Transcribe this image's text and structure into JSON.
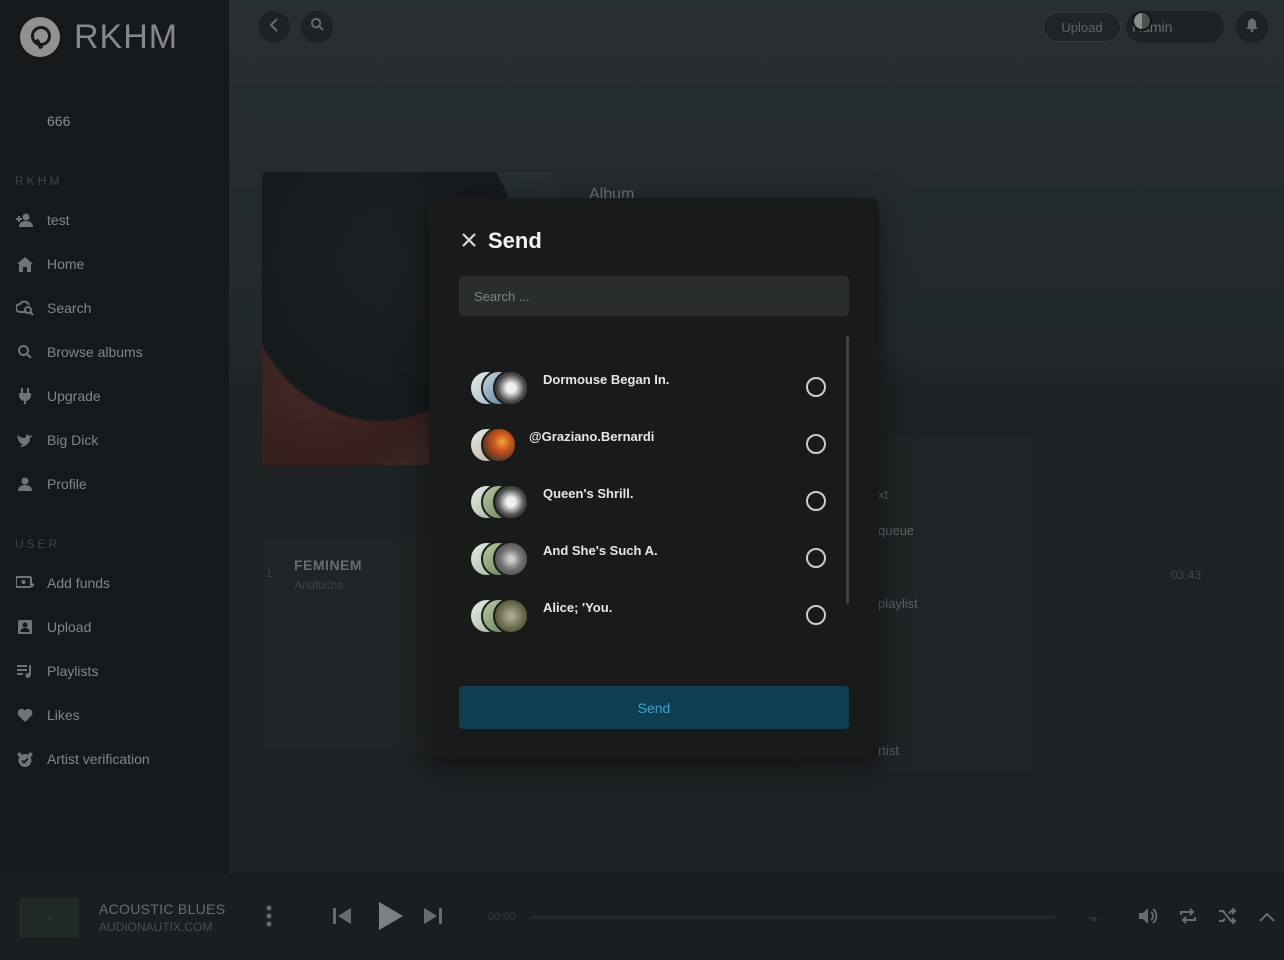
{
  "app": {
    "name": "RKHM"
  },
  "sidebar": {
    "balance": "666",
    "section_rkhm": "RKHM",
    "section_user": "USER",
    "items": [
      {
        "label": "test",
        "icon": "add-user-icon"
      },
      {
        "label": "Home",
        "icon": "home-icon"
      },
      {
        "label": "Search",
        "icon": "search-cloud-icon"
      },
      {
        "label": "Browse albums",
        "icon": "search-icon"
      },
      {
        "label": "Upgrade",
        "icon": "plug-icon"
      },
      {
        "label": "Big Dick",
        "icon": "bird-icon"
      },
      {
        "label": "Profile",
        "icon": "user-icon"
      }
    ],
    "user_items": [
      {
        "label": "Add funds",
        "icon": "money-icon"
      },
      {
        "label": "Upload",
        "icon": "upload-icon"
      },
      {
        "label": "Playlists",
        "icon": "playlist-icon"
      },
      {
        "label": "Likes",
        "icon": "heart-icon"
      },
      {
        "label": "Artist verification",
        "icon": "verification-icon"
      }
    ]
  },
  "topbar": {
    "upload_label": "Upload",
    "user_name": "Ramin"
  },
  "album": {
    "type_label": "Album"
  },
  "tracks": [
    {
      "number": "1",
      "title": "FEMINEM",
      "artist": "Antifuchs",
      "duration": "03:43"
    }
  ],
  "context_menu": {
    "items": [
      "xt",
      "queue",
      "playlist",
      "rtist"
    ]
  },
  "player": {
    "title": "ACOUSTIC BLUES",
    "subtitle": "AUDIONAUTIX.COM",
    "current_time": "00:00"
  },
  "modal": {
    "title": "Send",
    "search_placeholder": "Search ...",
    "send_label": "Send",
    "recipients": [
      {
        "name": "Dormouse Began In.",
        "selected": false
      },
      {
        "name": "@Graziano.Bernardi",
        "selected": false
      },
      {
        "name": "Queen's Shrill.",
        "selected": false
      },
      {
        "name": "And She's Such A.",
        "selected": false
      },
      {
        "name": "Alice; 'You.",
        "selected": false
      }
    ]
  },
  "colors": {
    "accent": "#3aa3cf",
    "send_button_bg": "#0f3e52",
    "modal_bg": "#191b1b",
    "sidebar_bg": "#1e2122"
  }
}
